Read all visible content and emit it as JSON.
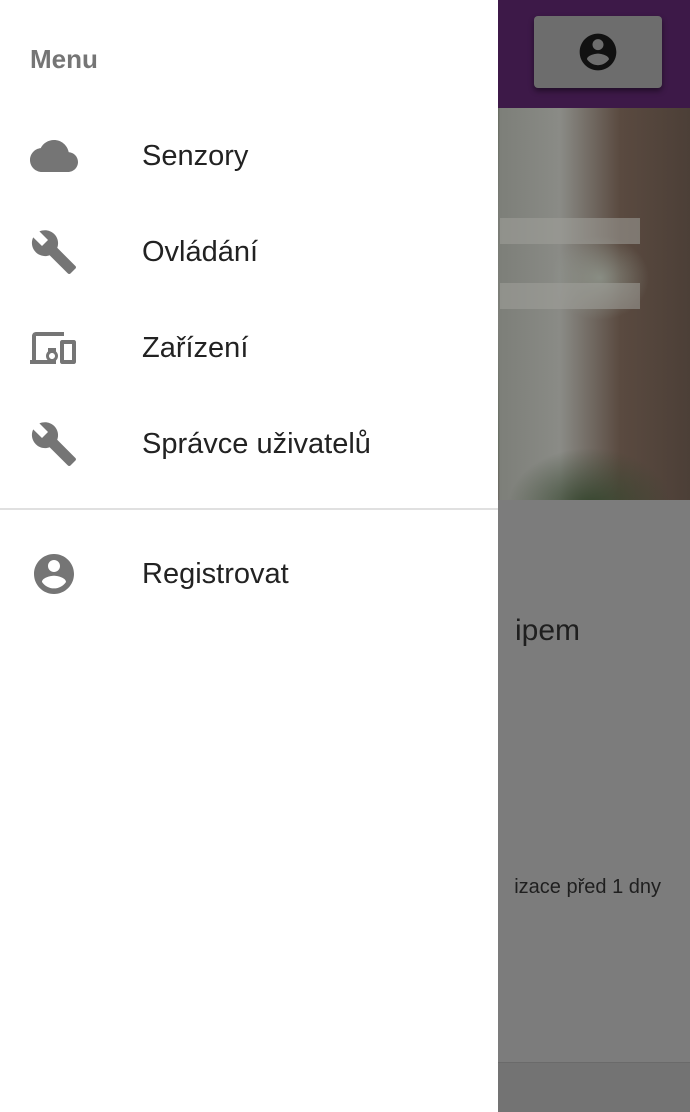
{
  "drawer": {
    "header": "Menu",
    "items": [
      {
        "label": "Senzory",
        "icon": "cloud-icon"
      },
      {
        "label": "Ovládání",
        "icon": "wrench-icon"
      },
      {
        "label": "Zařízení",
        "icon": "devices-icon"
      },
      {
        "label": "Správce uživatelů",
        "icon": "wrench-icon"
      }
    ],
    "secondary_items": [
      {
        "label": "Registrovat",
        "icon": "account-circle-icon"
      }
    ]
  },
  "background": {
    "card_title": "ipem",
    "card_subtitle": "izace před 1 dny",
    "account_icon": "account-circle-icon"
  },
  "colors": {
    "appbar": "#3d1948",
    "icon_gray": "#757575",
    "scrim_card": "#7c7c7c"
  }
}
